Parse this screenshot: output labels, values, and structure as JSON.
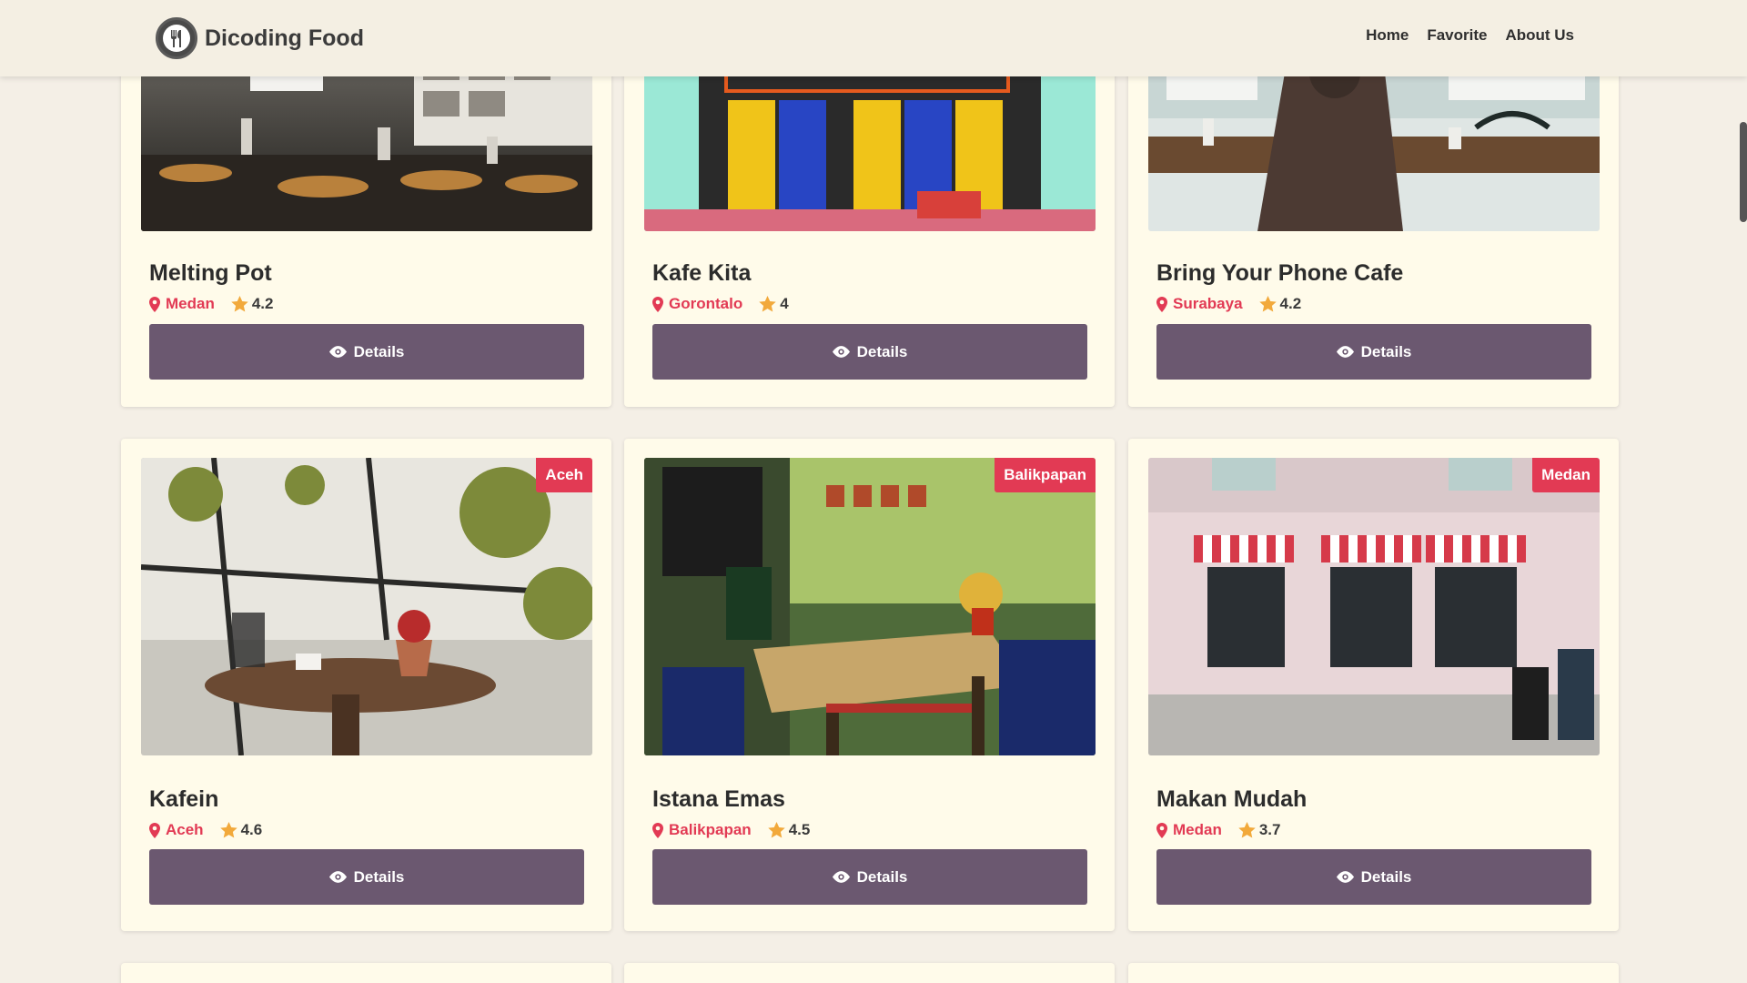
{
  "header": {
    "title": "Dicoding Food",
    "nav": [
      {
        "label": "Home"
      },
      {
        "label": "Favorite"
      },
      {
        "label": "About Us"
      }
    ]
  },
  "restaurants": [
    {
      "name": "Melting Pot",
      "city": "Medan",
      "rating": "4.2",
      "details_label": "Details"
    },
    {
      "name": "Kafe Kita",
      "city": "Gorontalo",
      "rating": "4",
      "details_label": "Details"
    },
    {
      "name": "Bring Your Phone Cafe",
      "city": "Surabaya",
      "rating": "4.2",
      "details_label": "Details"
    },
    {
      "name": "Kafein",
      "city": "Aceh",
      "rating": "4.6",
      "badge": "Aceh",
      "details_label": "Details"
    },
    {
      "name": "Istana Emas",
      "city": "Balikpapan",
      "rating": "4.5",
      "badge": "Balikpapan",
      "details_label": "Details"
    },
    {
      "name": "Makan Mudah",
      "city": "Medan",
      "rating": "3.7",
      "badge": "Medan",
      "details_label": "Details"
    }
  ],
  "colors": {
    "accent": "#e23a54",
    "button": "#6b5870",
    "star": "#f2a93b",
    "card": "#fffbea"
  },
  "icons": [
    "map-pin-icon",
    "star-icon",
    "eye-icon",
    "restaurant-logo-icon"
  ]
}
